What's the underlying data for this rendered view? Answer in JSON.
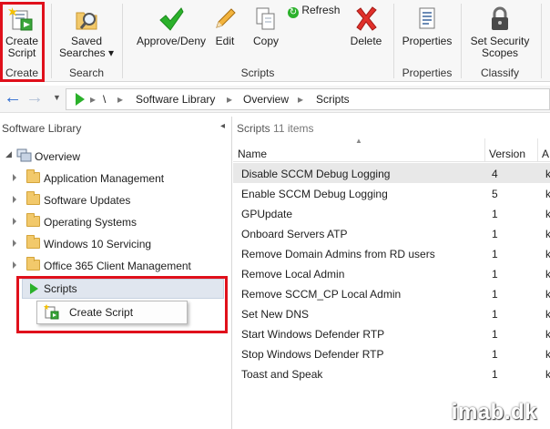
{
  "ribbon": {
    "groups": [
      {
        "label": "Create"
      },
      {
        "label": "Search"
      },
      {
        "label": "Scripts"
      },
      {
        "label": "Properties"
      },
      {
        "label": "Classify"
      }
    ],
    "buttons": {
      "create_script": "Create Script",
      "saved_searches": "Saved Searches",
      "approve_deny": "Approve/Deny",
      "edit": "Edit",
      "copy": "Copy",
      "refresh": "Refresh",
      "delete": "Delete",
      "properties": "Properties",
      "set_security_scopes": "Set Security Scopes"
    }
  },
  "address_bar": {
    "breadcrumbs": [
      "\\",
      "Software Library",
      "Overview",
      "Scripts"
    ]
  },
  "nav": {
    "title": "Software Library",
    "overview": "Overview",
    "items": [
      {
        "label": "Application Management"
      },
      {
        "label": "Software Updates"
      },
      {
        "label": "Operating Systems"
      },
      {
        "label": "Windows 10 Servicing"
      },
      {
        "label": "Office 365 Client Management"
      },
      {
        "label": "Scripts"
      }
    ],
    "context_menu": {
      "item": "Create Script"
    }
  },
  "pane": {
    "title": "Scripts",
    "count": "11 items",
    "columns": [
      "Name",
      "Version",
      "A"
    ],
    "rows": [
      {
        "name": "Disable SCCM Debug Logging",
        "version": "4",
        "approval": "k"
      },
      {
        "name": "Enable SCCM Debug Logging",
        "version": "5",
        "approval": "k"
      },
      {
        "name": "GPUpdate",
        "version": "1",
        "approval": "k"
      },
      {
        "name": "Onboard Servers ATP",
        "version": "1",
        "approval": "k"
      },
      {
        "name": "Remove Domain Admins from RD users",
        "version": "1",
        "approval": "k"
      },
      {
        "name": "Remove Local Admin",
        "version": "1",
        "approval": "k"
      },
      {
        "name": "Remove SCCM_CP Local Admin",
        "version": "1",
        "approval": "k"
      },
      {
        "name": "Set New DNS",
        "version": "1",
        "approval": "k"
      },
      {
        "name": "Start Windows Defender RTP",
        "version": "1",
        "approval": "k"
      },
      {
        "name": "Stop Windows Defender RTP",
        "version": "1",
        "approval": "k"
      },
      {
        "name": "Toast and Speak",
        "version": "1",
        "approval": "k"
      }
    ]
  },
  "watermark": "imab.dk",
  "colors": {
    "highlight": "#e0101b",
    "accent_green": "#2bb12b",
    "selected_row": "#e8e8e8"
  }
}
